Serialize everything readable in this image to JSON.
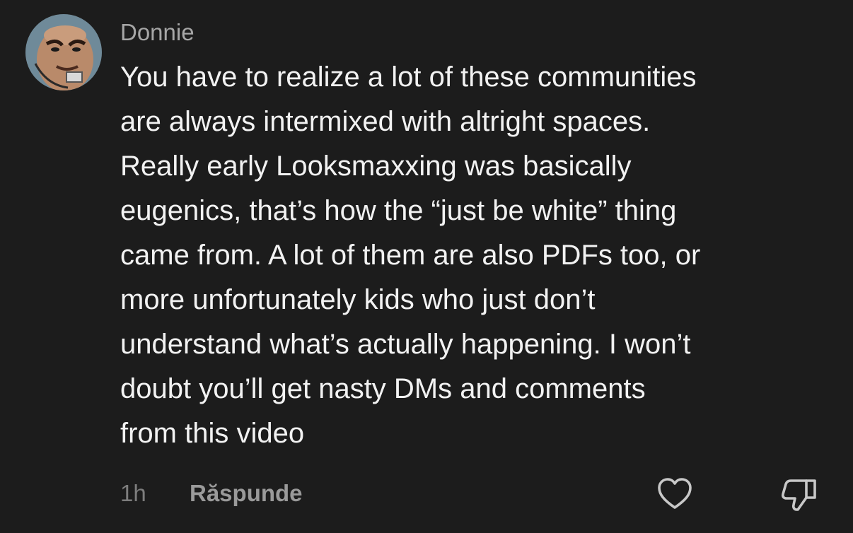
{
  "comment": {
    "username": "Donnie",
    "avatar_icon": "cartoon-avatar-icon",
    "text_lines": [
      "You have to realize a lot of these communities",
      "are always intermixed with altright spaces.",
      "Really early Looksmaxxing was basically",
      "eugenics, that’s how the “just be white” thing",
      "came from. A lot of them are also PDFs too, or",
      "more unfortunately kids who just don’t",
      "understand what’s actually happening. I won’t",
      "doubt you’ll get nasty DMs and comments",
      "from this video"
    ],
    "timestamp": "1h",
    "reply_label": "Răspunde",
    "like_icon": "heart-icon",
    "dislike_icon": "thumbs-down-icon"
  },
  "colors": {
    "background": "#1c1c1c",
    "username": "#a6a6a6",
    "text": "#f2f2f2",
    "meta": "#7d7d7d",
    "icons": "#c8c8c8"
  }
}
